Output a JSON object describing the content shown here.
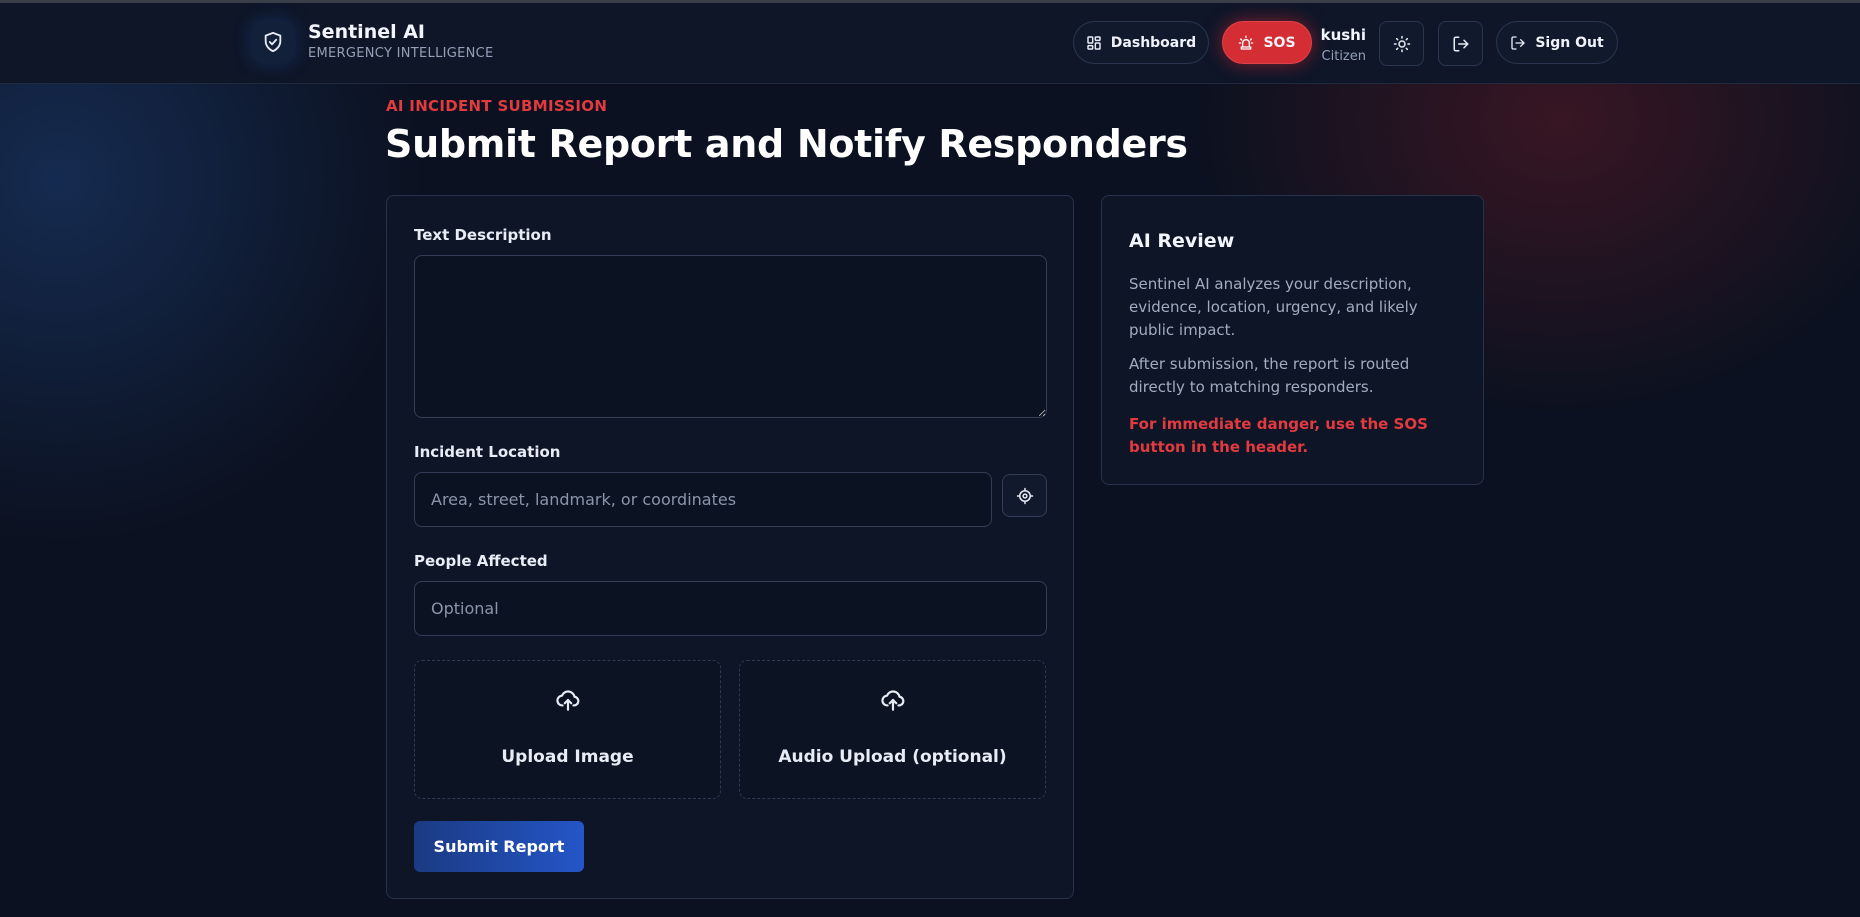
{
  "brand": {
    "title": "Sentinel AI",
    "subtitle": "EMERGENCY INTELLIGENCE",
    "icon": "shield-check-icon"
  },
  "header": {
    "dashboard_label": "Dashboard",
    "dashboard_icon": "grid-icon",
    "sos_label": "SOS",
    "sos_icon": "siren-icon",
    "user_name": "kushi",
    "user_role": "Citizen",
    "theme_icon": "sun-icon",
    "exit_icon": "logout-icon",
    "signout_label": "Sign Out",
    "signout_icon": "logout-icon"
  },
  "page": {
    "eyebrow": "AI INCIDENT SUBMISSION",
    "title": "Submit Report and Notify Responders"
  },
  "form": {
    "description_label": "Text Description",
    "description_value": "",
    "location_label": "Incident Location",
    "location_placeholder": "Area, street, landmark, or coordinates",
    "location_value": "",
    "people_label": "People Affected",
    "people_placeholder": "Optional",
    "people_value": "",
    "upload_image_label": "Upload Image",
    "upload_audio_label": "Audio Upload (optional)",
    "submit_label": "Submit Report"
  },
  "review": {
    "title": "AI Review",
    "paragraph1": "Sentinel AI analyzes your description, evidence, location, urgency, and likely public impact.",
    "paragraph2": "After submission, the report is routed directly to matching responders.",
    "warning": "For immediate danger, use the SOS button in the header."
  },
  "colors": {
    "background": "#0b1120",
    "accent_red": "#e23a3f",
    "sos_red": "#d42d34",
    "primary_blue": "#2456c8",
    "card_border": "#27324a"
  }
}
